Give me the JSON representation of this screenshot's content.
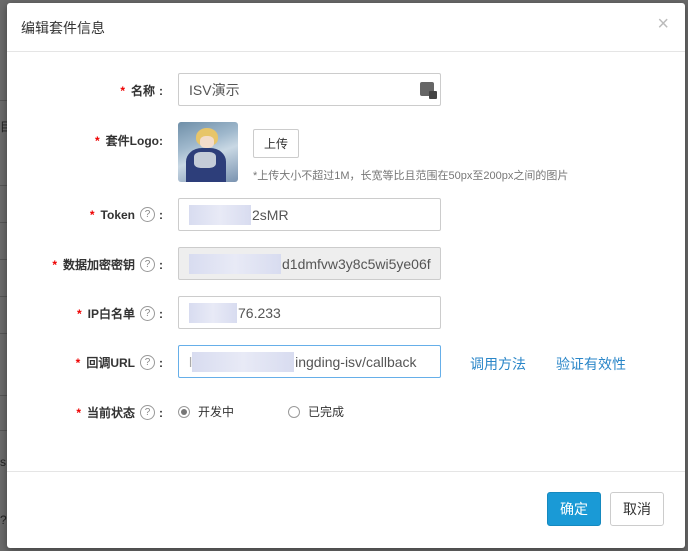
{
  "dialog": {
    "title": "编辑套件信息",
    "close_label": "×"
  },
  "background": {
    "side_chars": [
      "目",
      "s",
      "?"
    ]
  },
  "form": {
    "name": {
      "required_mark": "*",
      "label": "名称",
      "value": "ISV演示"
    },
    "logo": {
      "required_mark": "*",
      "label": "套件Logo:",
      "upload_label": "上传",
      "hint": "*上传大小不超过1M，长宽等比且范围在50px至200px之间的图片"
    },
    "token": {
      "required_mark": "*",
      "label": "Token",
      "help": "?",
      "colon": ":",
      "value_visible": "2sMR"
    },
    "encrypt_key": {
      "required_mark": "*",
      "label": "数据加密密钥",
      "help": "?",
      "colon": ":",
      "value_visible": "d1dmfvw3y8c5wi5ye06f"
    },
    "ip_whitelist": {
      "required_mark": "*",
      "label": "IP白名单",
      "help": "?",
      "colon": ":",
      "value_visible": "76.233"
    },
    "callback_url": {
      "required_mark": "*",
      "label": "回调URL",
      "help": "?",
      "colon": ":",
      "value_prefix": "l",
      "value_visible": "ingding-isv/callback",
      "link_usage": "调用方法",
      "link_verify": "验证有效性"
    },
    "status": {
      "required_mark": "*",
      "label": "当前状态",
      "help": "?",
      "colon": ":",
      "options": [
        {
          "label": "开发中",
          "checked": true
        },
        {
          "label": "已完成",
          "checked": false
        }
      ]
    }
  },
  "footer": {
    "confirm_label": "确定",
    "cancel_label": "取消"
  },
  "colors": {
    "primary": "#1a9ad6",
    "link": "#2a86c8",
    "required": "#e00000"
  }
}
